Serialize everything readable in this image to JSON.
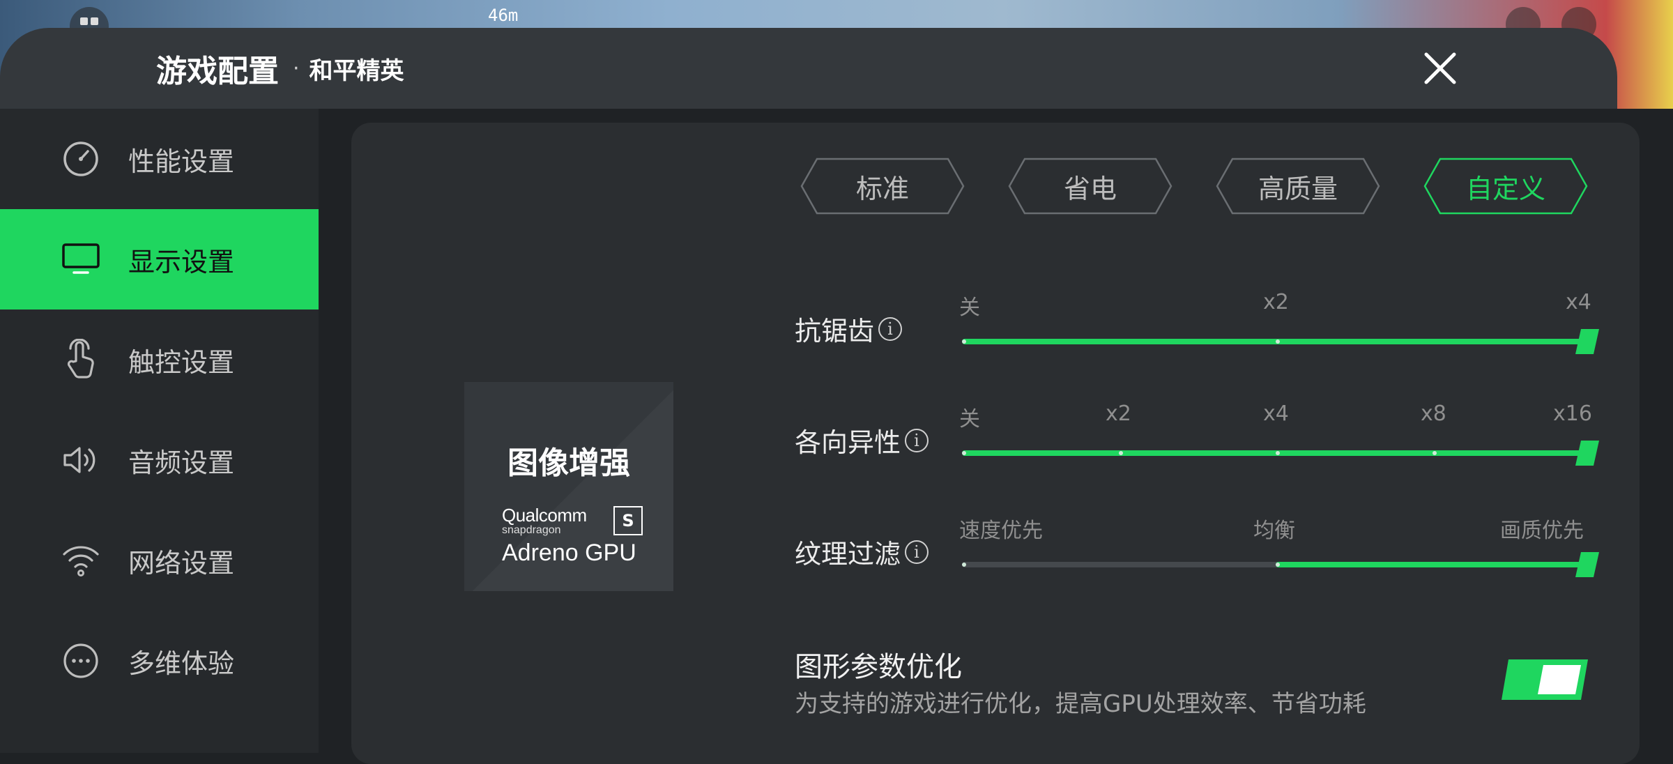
{
  "header": {
    "title": "游戏配置",
    "separator": "·",
    "game_name": "和平精英"
  },
  "game_hud": {
    "distance": "46m"
  },
  "sidebar": {
    "items": [
      {
        "label": "性能设置",
        "icon": "speedometer-icon",
        "active": false
      },
      {
        "label": "显示设置",
        "icon": "monitor-icon",
        "active": true
      },
      {
        "label": "触控设置",
        "icon": "touch-hand-icon",
        "active": false
      },
      {
        "label": "音频设置",
        "icon": "speaker-icon",
        "active": false
      },
      {
        "label": "网络设置",
        "icon": "wifi-icon",
        "active": false
      },
      {
        "label": "多维体验",
        "icon": "more-dots-icon",
        "active": false
      }
    ]
  },
  "card": {
    "title": "图像增强",
    "brand_line1": "Qualcomm",
    "brand_line2": "snapdragon",
    "brand_line3": "Adreno GPU"
  },
  "presets": {
    "tabs": [
      "标准",
      "省电",
      "高质量",
      "自定义"
    ],
    "selected": "自定义"
  },
  "settings": {
    "anti_aliasing": {
      "label": "抗锯齿",
      "ticks": [
        "关",
        "x2",
        "x4"
      ],
      "level": 1.0,
      "fill_from": 0
    },
    "anisotropic": {
      "label": "各向异性",
      "ticks": [
        "关",
        "x2",
        "x4",
        "x8",
        "x16"
      ],
      "level": 1.0,
      "fill_from": 0
    },
    "texture_filter": {
      "label": "纹理过滤",
      "ticks": [
        "速度优先",
        "均衡",
        "画质优先"
      ],
      "level": 1.0,
      "fill_from": 0.5
    }
  },
  "graphics_opt": {
    "title": "图形参数优化",
    "description": "为支持的游戏进行优化，提高GPU处理效率、节省功耗",
    "enabled": true
  },
  "colors": {
    "accent": "#1fd65f",
    "panel": "#2b2e31",
    "sidebar": "#26292c"
  }
}
